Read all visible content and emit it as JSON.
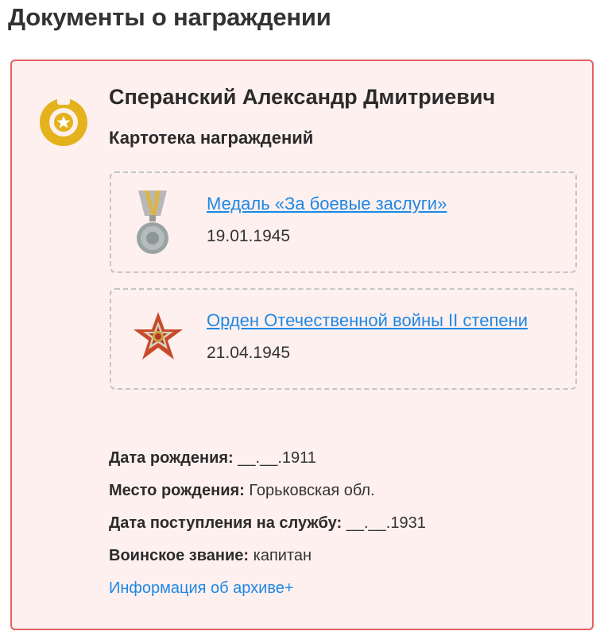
{
  "page": {
    "title": "Документы о награждении"
  },
  "person": {
    "name": "Сперанский Александр Дмитриевич",
    "section_label": "Картотека награждений"
  },
  "awards": [
    {
      "name": "Медаль «За боевые заслуги»",
      "date": "19.01.1945",
      "icon": "medal-icon"
    },
    {
      "name": "Орден Отечественной войны II степени",
      "date": "21.04.1945",
      "icon": "order-star-icon"
    }
  ],
  "details": [
    {
      "label": "Дата рождения:",
      "value": "__.__.1911"
    },
    {
      "label": "Место рождения:",
      "value": "Горьковская обл."
    },
    {
      "label": "Дата поступления на службу:",
      "value": "__.__.1931"
    },
    {
      "label": "Воинское звание:",
      "value": "капитан"
    }
  ],
  "archive_link": "Информация об архиве+",
  "colors": {
    "card_border": "#e06060",
    "card_background": "#fff0f0",
    "link": "#1e88e5",
    "badge_gold": "#e3b21c"
  }
}
